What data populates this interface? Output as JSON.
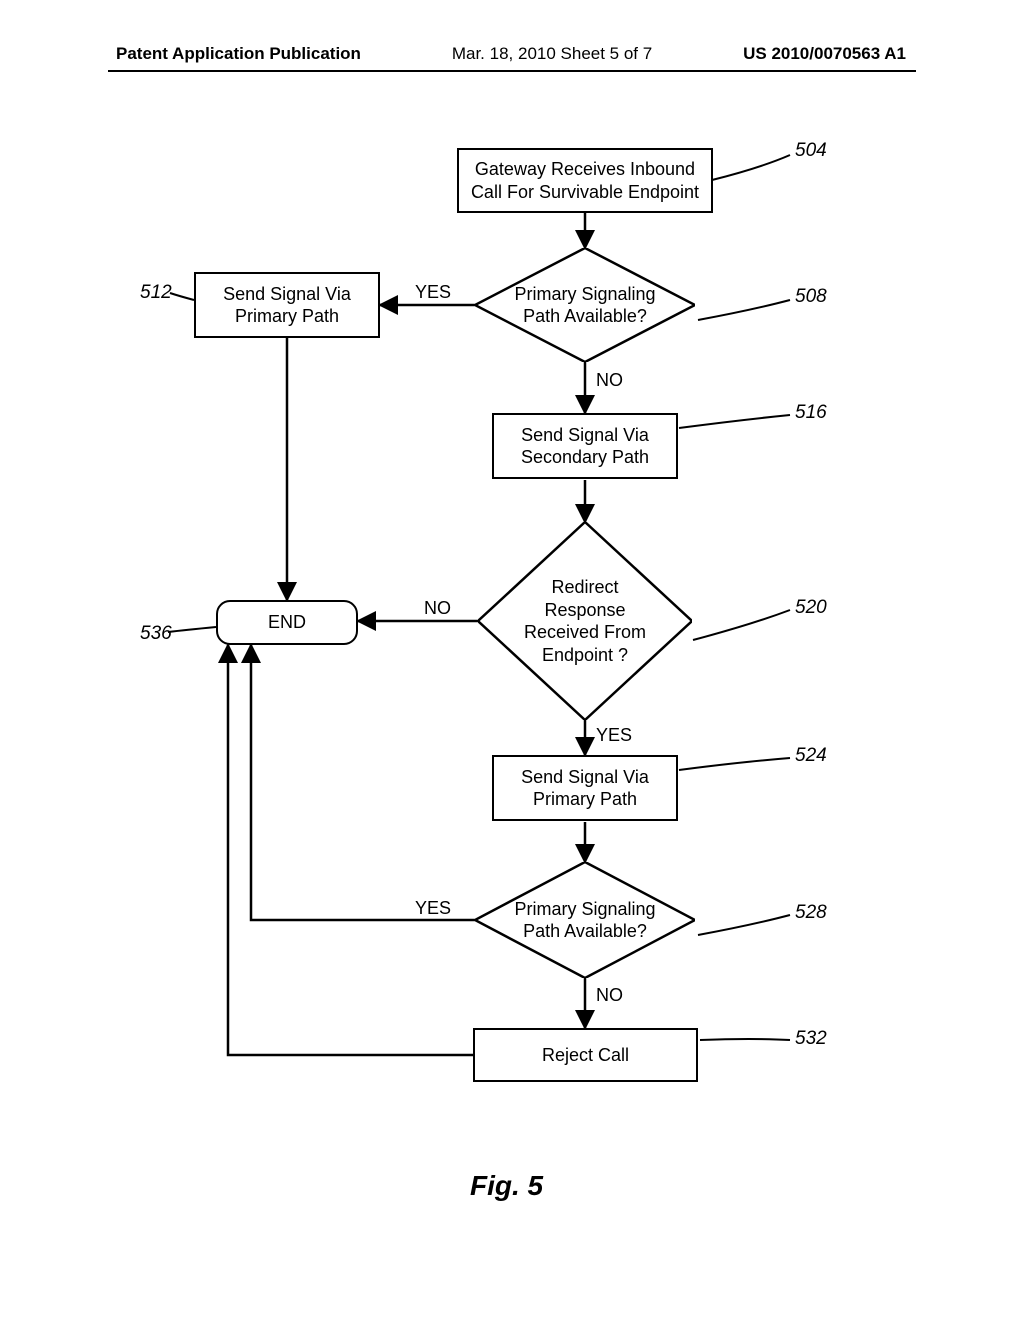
{
  "header": {
    "left": "Patent Application Publication",
    "center": "Mar. 18, 2010  Sheet 5 of 7",
    "right": "US 2010/0070563 A1"
  },
  "refs": {
    "r504": "504",
    "r508": "508",
    "r512": "512",
    "r516": "516",
    "r520": "520",
    "r524": "524",
    "r528": "528",
    "r532": "532",
    "r536": "536"
  },
  "nodes": {
    "n504": "Gateway Receives Inbound\nCall For Survivable Endpoint",
    "n508": "Primary Signaling\nPath Available?",
    "n512": "Send Signal Via\nPrimary Path",
    "n516": "Send Signal Via\nSecondary Path",
    "n520": "Redirect\nResponse\nReceived From\nEndpoint ?",
    "n524": "Send Signal Via\nPrimary Path",
    "n528": "Primary Signaling\nPath Available?",
    "n532": "Reject Call",
    "n536": "END"
  },
  "labels": {
    "yes": "YES",
    "no": "NO"
  },
  "figure": "Fig. 5",
  "chart_data": {
    "type": "flowchart",
    "title": "Fig. 5",
    "nodes": [
      {
        "id": "504",
        "kind": "process",
        "text": "Gateway Receives Inbound Call For Survivable Endpoint"
      },
      {
        "id": "508",
        "kind": "decision",
        "text": "Primary Signaling Path Available?"
      },
      {
        "id": "512",
        "kind": "process",
        "text": "Send Signal Via Primary Path"
      },
      {
        "id": "516",
        "kind": "process",
        "text": "Send Signal Via Secondary Path"
      },
      {
        "id": "520",
        "kind": "decision",
        "text": "Redirect Response Received From Endpoint ?"
      },
      {
        "id": "524",
        "kind": "process",
        "text": "Send Signal Via Primary Path"
      },
      {
        "id": "528",
        "kind": "decision",
        "text": "Primary Signaling Path Available?"
      },
      {
        "id": "532",
        "kind": "process",
        "text": "Reject Call"
      },
      {
        "id": "536",
        "kind": "terminator",
        "text": "END"
      }
    ],
    "edges": [
      {
        "from": "504",
        "to": "508",
        "label": ""
      },
      {
        "from": "508",
        "to": "512",
        "label": "YES"
      },
      {
        "from": "508",
        "to": "516",
        "label": "NO"
      },
      {
        "from": "512",
        "to": "536",
        "label": ""
      },
      {
        "from": "516",
        "to": "520",
        "label": ""
      },
      {
        "from": "520",
        "to": "536",
        "label": "NO"
      },
      {
        "from": "520",
        "to": "524",
        "label": "YES"
      },
      {
        "from": "524",
        "to": "528",
        "label": ""
      },
      {
        "from": "528",
        "to": "536",
        "label": "YES"
      },
      {
        "from": "528",
        "to": "532",
        "label": "NO"
      },
      {
        "from": "532",
        "to": "536",
        "label": ""
      }
    ]
  }
}
